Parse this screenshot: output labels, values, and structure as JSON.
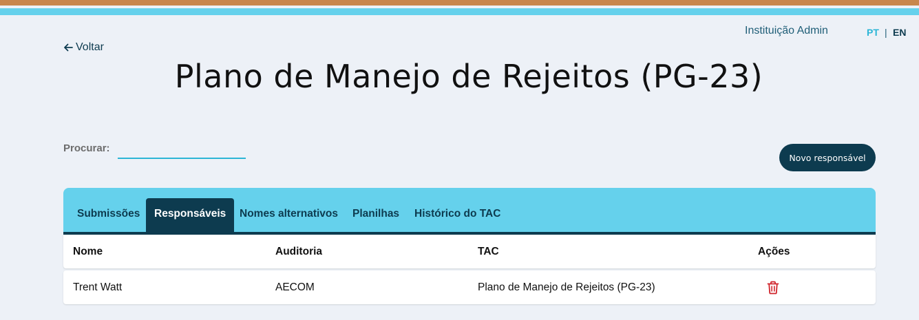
{
  "header": {
    "institution": "Instituição Admin",
    "lang_pt": "PT",
    "lang_separator": "|",
    "lang_en": "EN"
  },
  "back_label": "Voltar",
  "page_title": "Plano de Manejo de Rejeitos (PG-23)",
  "search": {
    "label": "Procurar:",
    "value": "",
    "placeholder": ""
  },
  "new_button_label": "Novo responsável",
  "tabs": [
    {
      "label": "Submissões",
      "active": false
    },
    {
      "label": "Responsáveis",
      "active": true
    },
    {
      "label": "Nomes alternativos",
      "active": false
    },
    {
      "label": "Planilhas",
      "active": false
    },
    {
      "label": "Histórico do TAC",
      "active": false
    }
  ],
  "table": {
    "columns": [
      "Nome",
      "Auditoria",
      "TAC",
      "Ações"
    ],
    "rows": [
      {
        "nome": "Trent Watt",
        "auditoria": "AECOM",
        "tac": "Plano de Manejo de Rejeitos (PG-23)",
        "action_icon": "trash-icon"
      }
    ]
  },
  "colors": {
    "top_stripe": "#c8864d",
    "accent_blue": "#65d1ec",
    "dark_navy": "#0d3b4f",
    "delete_red": "#d0242b"
  }
}
